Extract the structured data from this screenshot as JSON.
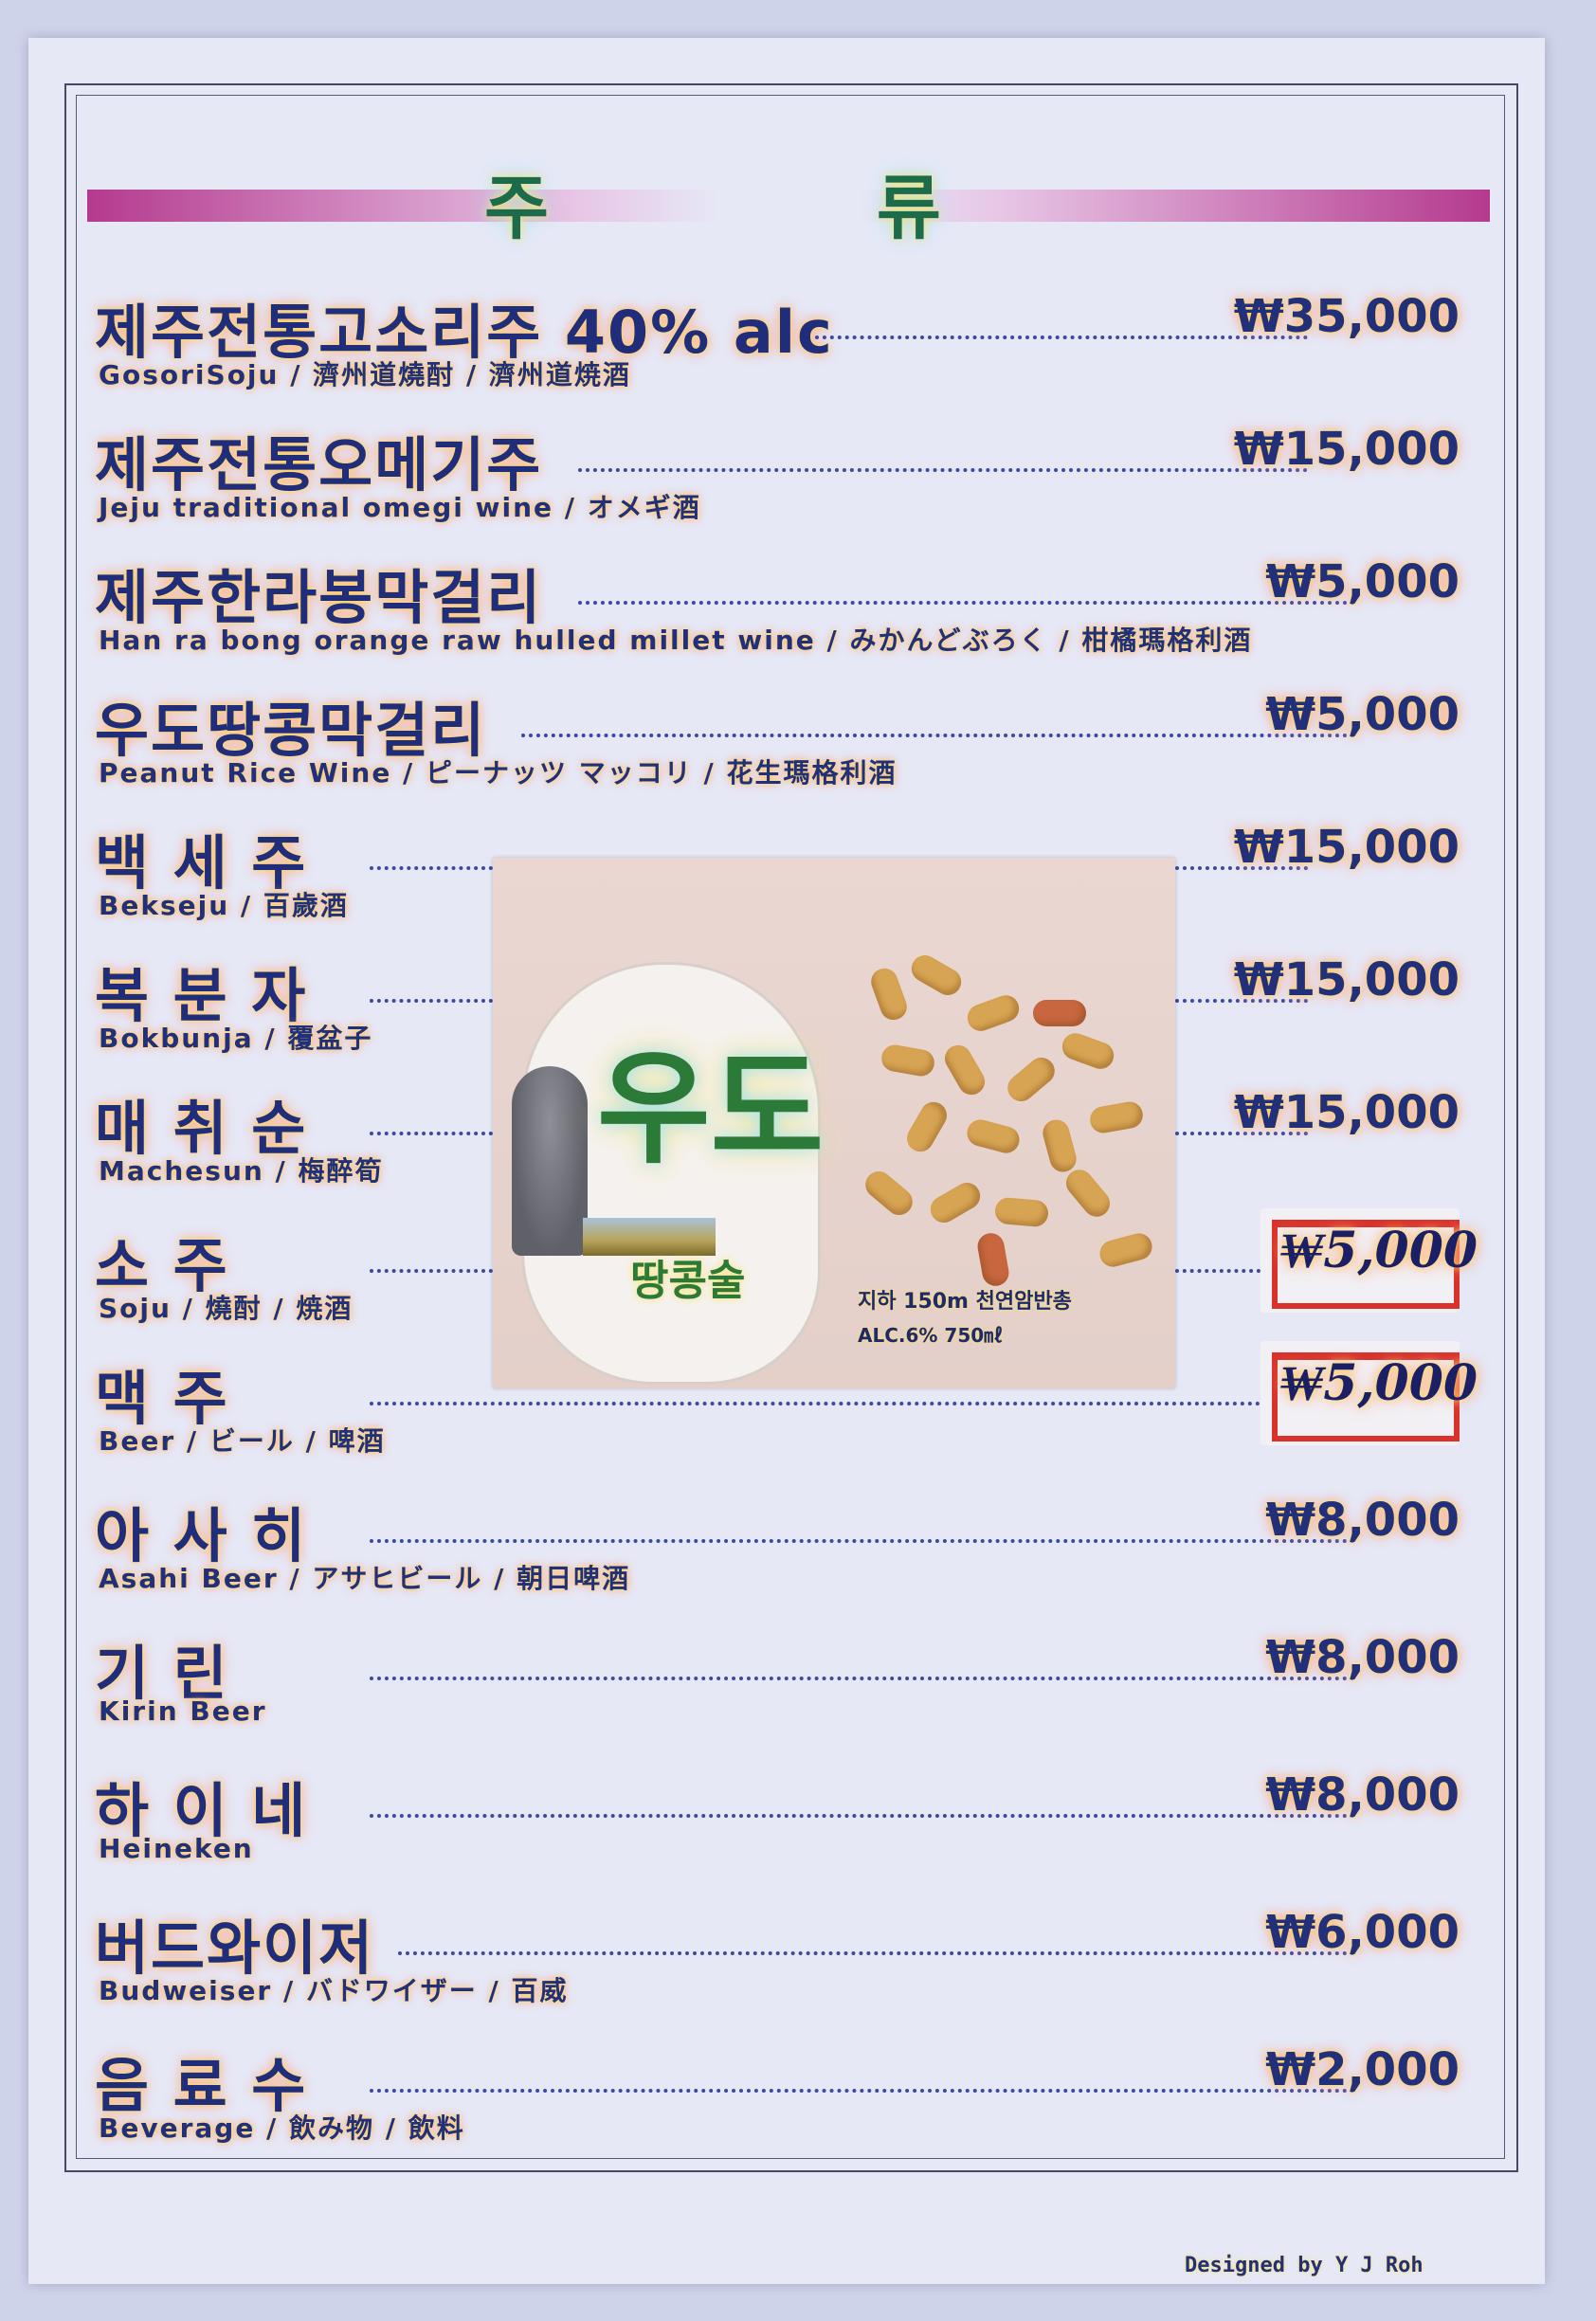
{
  "header": {
    "title": "주  류"
  },
  "items": [
    {
      "name": "제주전통고소리주 40% alc",
      "sub": "GosoriSoju / 濟州道燒酎 / 濟州道焼酒",
      "price": "₩35,000"
    },
    {
      "name": "제주전통오메기주",
      "sub": "Jeju traditional omegi wine / オメギ酒",
      "price": "₩15,000"
    },
    {
      "name": "제주한라봉막걸리",
      "sub": "Han ra bong orange raw hulled millet wine / みかんどぶろく / 柑橘瑪格利酒",
      "price": "₩5,000"
    },
    {
      "name": "우도땅콩막걸리",
      "sub": "Peanut Rice Wine / ピーナッツ マッコリ / 花生瑪格利酒",
      "price": "₩5,000"
    },
    {
      "name": "백 세 주",
      "sub": "Bekseju / 百歲酒",
      "price": "₩15,000"
    },
    {
      "name": "복 분 자",
      "sub": "Bokbunja / 覆盆子",
      "price": "₩15,000"
    },
    {
      "name": "매 취 순",
      "sub": "Machesun / 梅醉筍",
      "price": "₩15,000"
    },
    {
      "name": "소     주",
      "sub": "Soju / 燒酎 / 焼酒",
      "price_handwritten": "₩5,000"
    },
    {
      "name": "맥     주",
      "sub": "Beer / ビール / 啤酒",
      "price_handwritten": "₩5,000"
    },
    {
      "name": "아 사 히",
      "sub": "Asahi Beer / アサヒビール / 朝日啤酒",
      "price": "₩8,000"
    },
    {
      "name": "기     린",
      "sub": "Kirin Beer",
      "price": "₩8,000"
    },
    {
      "name": "하 이 네",
      "sub": "Heineken",
      "price": "₩8,000"
    },
    {
      "name": "버드와이저",
      "sub": "Budweiser / バドワイザー / 百威",
      "price": "₩6,000"
    },
    {
      "name": "음 료 수",
      "sub": "Beverage / 飲み物 / 飲料",
      "price": "₩2,000"
    }
  ],
  "ad": {
    "logo": "우도",
    "logo_sub": "땅콩술",
    "depth": "지하 150m 천연암반총",
    "alc": "ALC.6% 750㎖"
  },
  "credit": "Designed by Y J Roh"
}
